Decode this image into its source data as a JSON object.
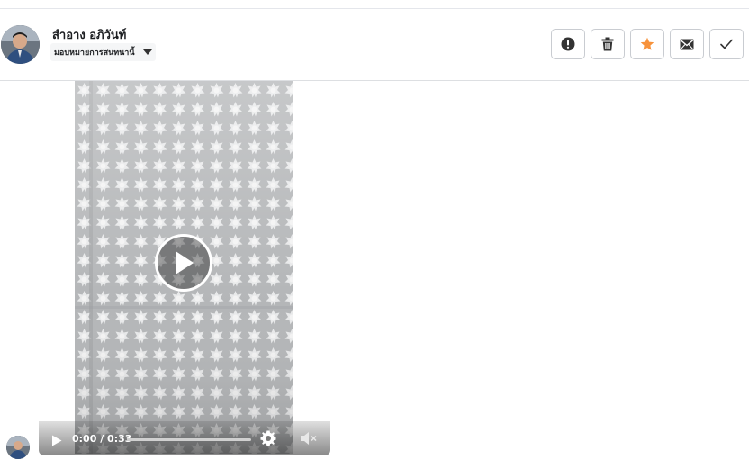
{
  "post": {
    "author_name": "สำอาง อภิวันท์",
    "assign_label": "มอบหมายการสนทนานี้"
  },
  "actions": [
    {
      "name": "report",
      "icon": "exclamation-circle-icon"
    },
    {
      "name": "delete",
      "icon": "trash-icon"
    },
    {
      "name": "star",
      "icon": "star-icon",
      "color": "#f7923b"
    },
    {
      "name": "message",
      "icon": "envelope-icon"
    },
    {
      "name": "done",
      "icon": "checkmark-icon"
    }
  ],
  "video": {
    "time_display": "0:00 / 0:33",
    "progress_fraction": 0.0,
    "muted": true
  },
  "colors": {
    "star": "#f7923b",
    "icon_dark": "#333333",
    "border": "#c9ccd1"
  }
}
